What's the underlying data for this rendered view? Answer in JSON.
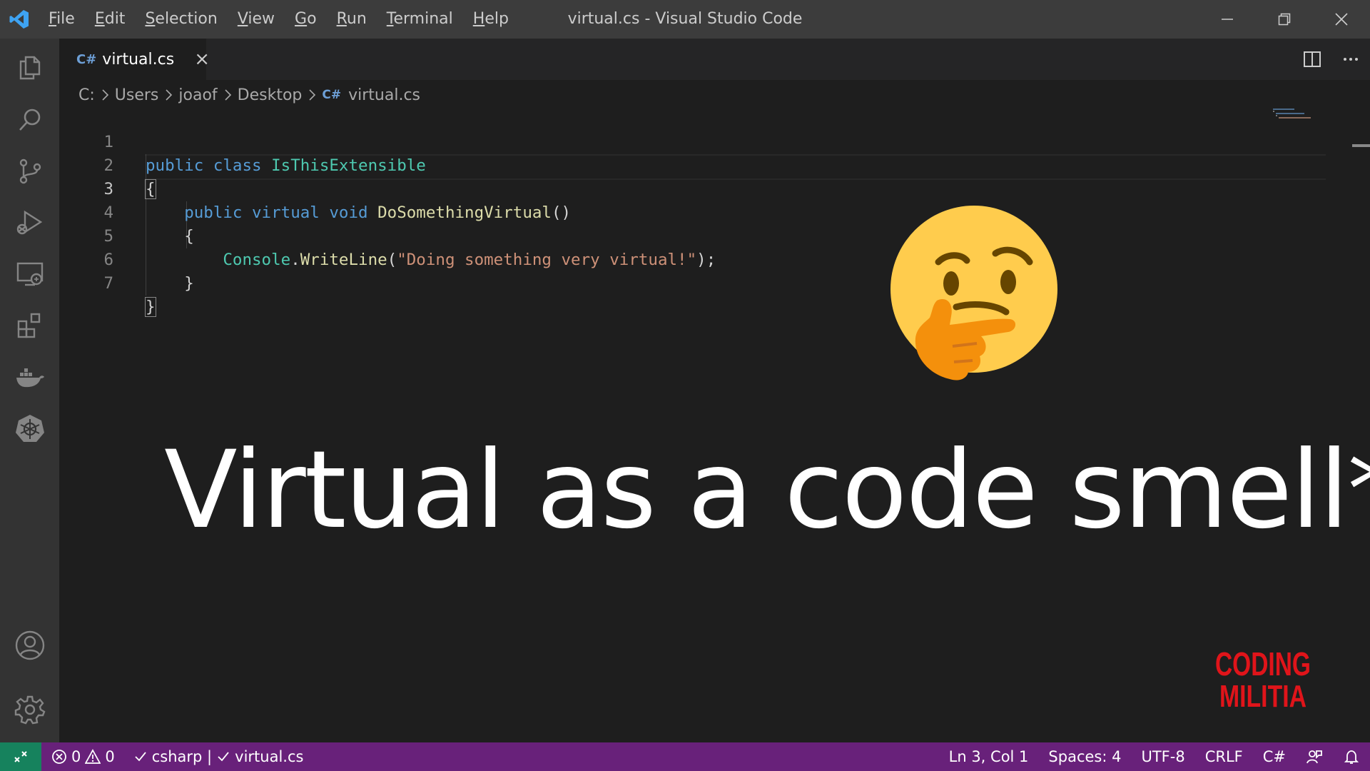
{
  "window": {
    "title": "virtual.cs - Visual Studio Code",
    "menu": [
      "File",
      "Edit",
      "Selection",
      "View",
      "Go",
      "Run",
      "Terminal",
      "Help"
    ],
    "menu_first_letters": [
      "F",
      "E",
      "S",
      "V",
      "G",
      "R",
      "T",
      "H"
    ],
    "menu_rest": [
      "ile",
      "dit",
      "election",
      "iew",
      "o",
      "un",
      "erminal",
      "elp"
    ]
  },
  "activity_bar": {
    "items": [
      "explorer-icon",
      "search-icon",
      "source-control-icon",
      "run-debug-icon",
      "remote-explorer-icon",
      "extensions-icon",
      "docker-icon",
      "kubernetes-icon"
    ],
    "bottom": [
      "accounts-icon",
      "settings-gear-icon"
    ]
  },
  "tab": {
    "icon": "C#",
    "label": "virtual.cs",
    "close": "×"
  },
  "breadcrumb": {
    "segments": [
      "C:",
      "Users",
      "joaof",
      "Desktop"
    ],
    "file_icon": "C#",
    "file": "virtual.cs"
  },
  "editor": {
    "line_numbers": [
      "1",
      "2",
      "3",
      "4",
      "5",
      "6",
      "7"
    ],
    "active_line": 3,
    "lines": {
      "l1_kw1": "public",
      "l1_kw2": "class",
      "l1_class": "IsThisExtensible",
      "l2": "{",
      "l3_kw1": "public",
      "l3_kw2": "virtual",
      "l3_kw3": "void",
      "l3_method": "DoSomethingVirtual",
      "l3_parens": "()",
      "l4": "{",
      "l5_class": "Console",
      "l5_dot": ".",
      "l5_method": "WriteLine",
      "l5_open": "(",
      "l5_string": "\"Doing something very virtual!\"",
      "l5_close": ");",
      "l6": "}",
      "l7": "}"
    }
  },
  "overlay": {
    "headline": "Virtual as a code smell*",
    "emoji": "thinking-face",
    "logo_line1": "CODING",
    "logo_line2": "MILITIA"
  },
  "status_bar": {
    "errors": "0",
    "warnings": "0",
    "language_check": "csharp |",
    "file_check": "virtual.cs",
    "cursor": "Ln 3, Col 1",
    "spaces": "Spaces: 4",
    "encoding": "UTF-8",
    "eol": "CRLF",
    "language": "C#"
  },
  "colors": {
    "statusbar": "#68217a",
    "remote": "#16825d",
    "keyword": "#569cd6",
    "class": "#4ec9b0",
    "function": "#dcdcaa",
    "string": "#ce9178",
    "logo_red": "#e0141a"
  }
}
